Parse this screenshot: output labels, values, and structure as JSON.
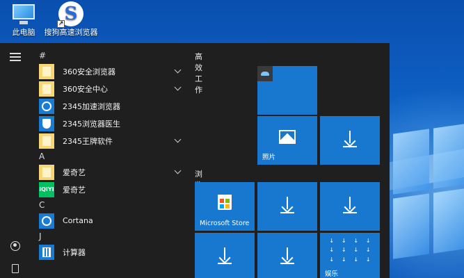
{
  "desktop": {
    "icons": [
      {
        "label": "此电脑",
        "icon": "this-pc-icon"
      },
      {
        "label": "搜狗高速浏览器",
        "icon": "sogou-browser-icon"
      }
    ]
  },
  "start_menu": {
    "rail": {
      "menu": "hamburger-menu-icon",
      "user": "user-icon",
      "documents": "document-icon"
    },
    "app_list": {
      "groups": [
        {
          "letter": "#",
          "apps": [
            {
              "name": "360安全浏览器",
              "icon": "folder-icon",
              "expandable": true
            },
            {
              "name": "360安全中心",
              "icon": "folder-icon",
              "expandable": true
            },
            {
              "name": "2345加速浏览器",
              "icon": "browser-icon",
              "expandable": false
            },
            {
              "name": "2345浏览器医生",
              "icon": "shield-icon",
              "expandable": false
            },
            {
              "name": "2345王牌软件",
              "icon": "folder-icon",
              "expandable": true
            }
          ]
        },
        {
          "letter": "A",
          "apps": [
            {
              "name": "爱奇艺",
              "icon": "folder-icon",
              "expandable": true
            },
            {
              "name": "爱奇艺",
              "icon": "iqiyi-icon",
              "expandable": false
            }
          ]
        },
        {
          "letter": "C",
          "apps": [
            {
              "name": "Cortana",
              "icon": "cortana-icon",
              "expandable": false
            }
          ]
        },
        {
          "letter": "J",
          "apps": [
            {
              "name": "计算器",
              "icon": "calculator-icon",
              "expandable": false
            }
          ]
        }
      ]
    },
    "tiles": {
      "sections": [
        {
          "title": "高效工作"
        },
        {
          "title": "浏览"
        }
      ],
      "labels": {
        "photos": "照片",
        "store": "Microsoft Store",
        "entertainment": "娱乐"
      },
      "colors": {
        "tile": "#1878cf",
        "menu_bg": "#1f1f1f"
      }
    }
  }
}
